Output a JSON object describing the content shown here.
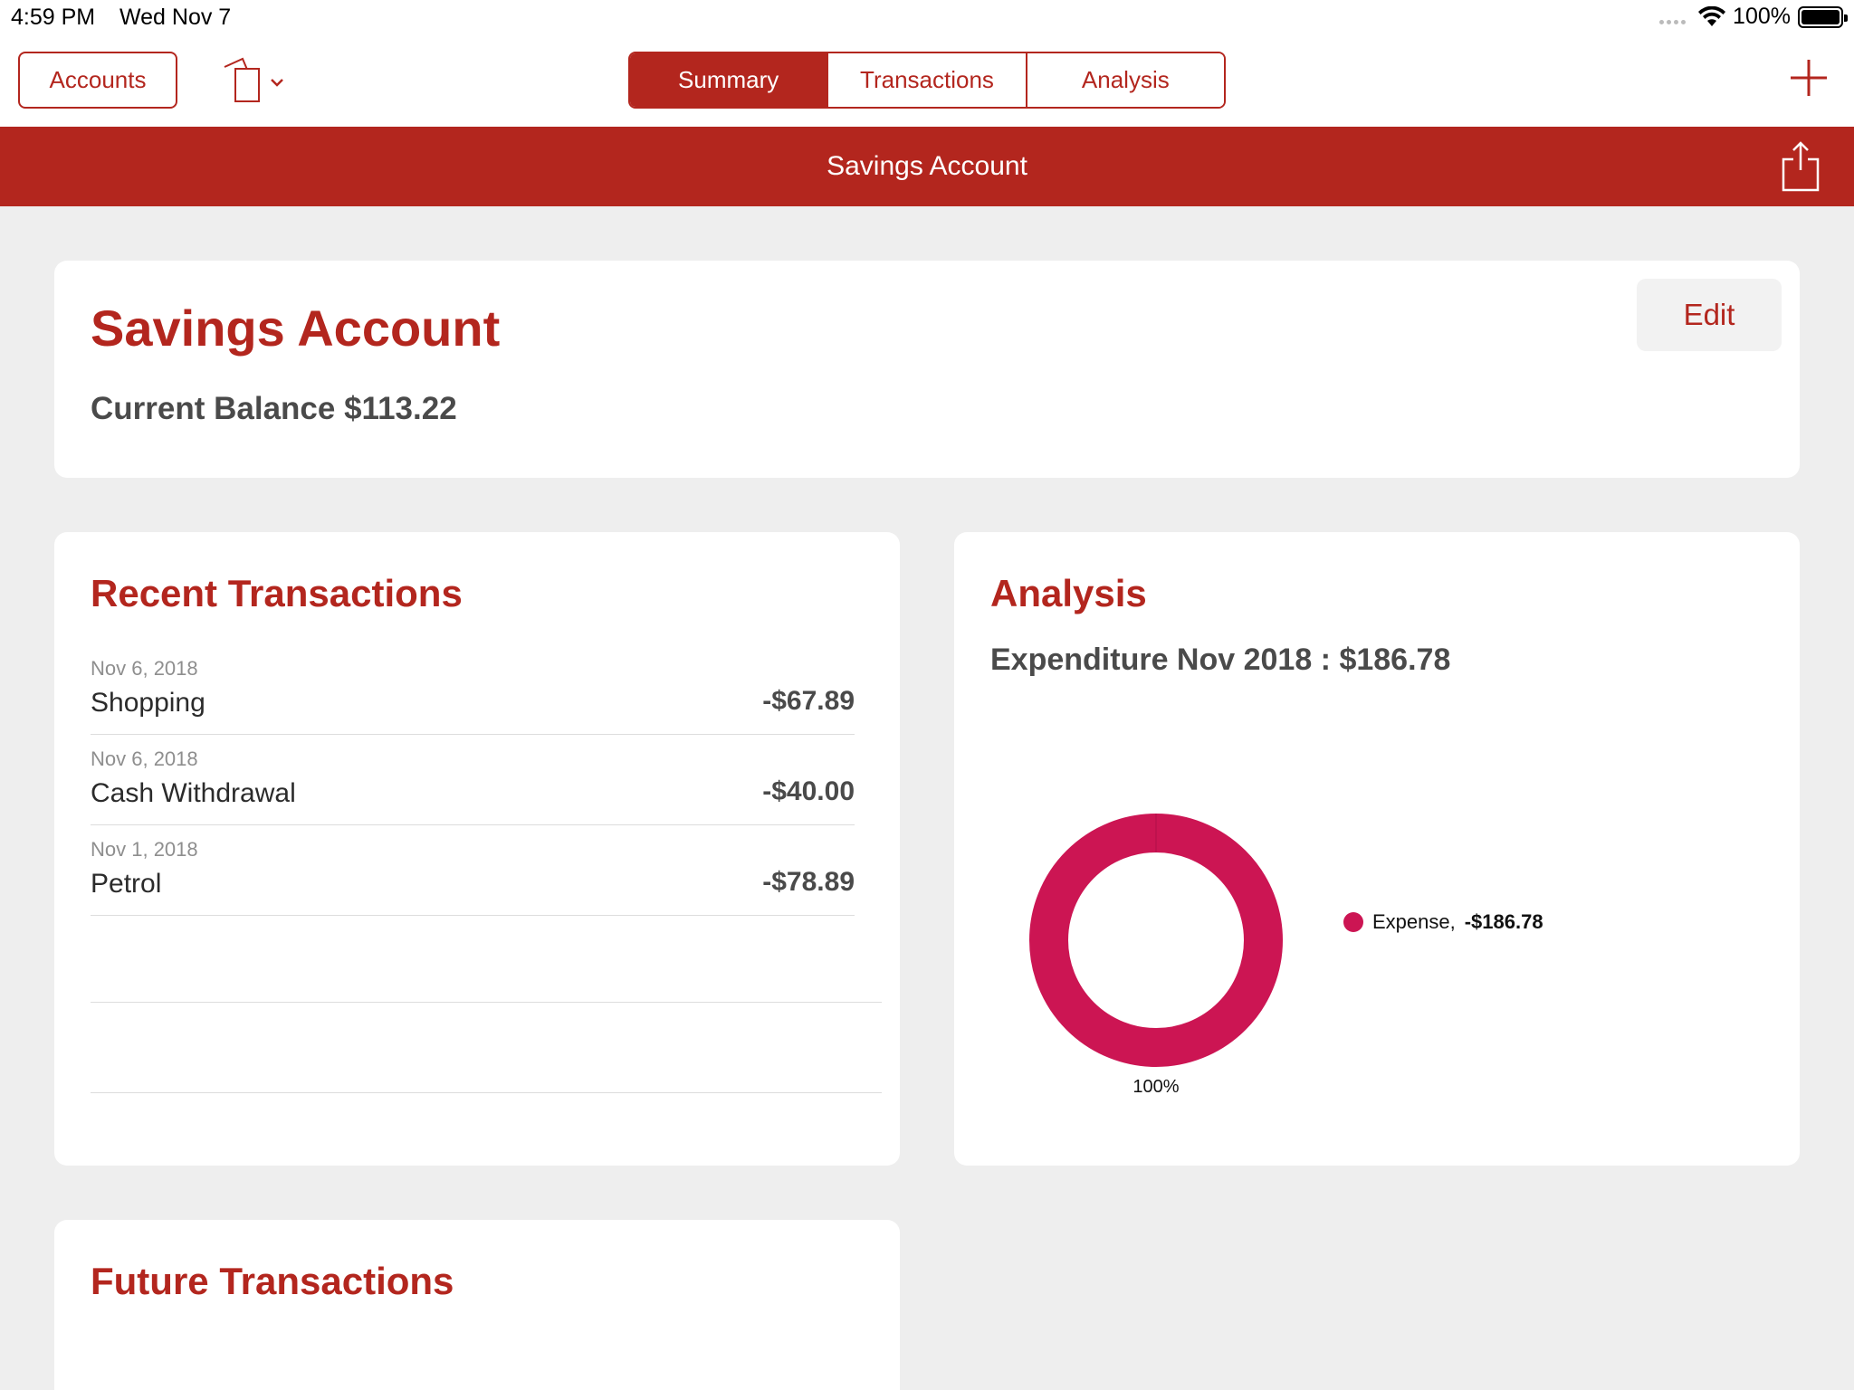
{
  "status_bar": {
    "time": "4:59 PM",
    "date": "Wed Nov 7",
    "battery": "100%",
    "icons": [
      "signal-dots-icon",
      "wifi-icon",
      "battery-icon"
    ]
  },
  "nav": {
    "accounts_label": "Accounts",
    "tabs": [
      {
        "label": "Summary",
        "active": true
      },
      {
        "label": "Transactions",
        "active": false
      },
      {
        "label": "Analysis",
        "active": false
      }
    ],
    "icons": [
      "cards-icon",
      "chevron-down-icon",
      "plus-icon"
    ]
  },
  "title_bar": {
    "title": "Savings Account",
    "icons": [
      "share-icon"
    ]
  },
  "account": {
    "name": "Savings Account",
    "balance_text": "Current Balance $113.22",
    "edit_label": "Edit"
  },
  "recent": {
    "heading": "Recent Transactions",
    "items": [
      {
        "date": "Nov 6, 2018",
        "name": "Shopping",
        "amount": "-$67.89"
      },
      {
        "date": "Nov 6, 2018",
        "name": "Cash Withdrawal",
        "amount": "-$40.00"
      },
      {
        "date": "Nov 1, 2018",
        "name": "Petrol",
        "amount": "-$78.89"
      }
    ]
  },
  "analysis": {
    "heading": "Analysis",
    "expenditure_text": "Expenditure Nov 2018 : $186.78",
    "legend_label": "Expense,",
    "legend_value": "-$186.78",
    "percent_label": "100%"
  },
  "future": {
    "heading": "Future Transactions"
  },
  "colors": {
    "brand_red": "#b3261e",
    "expense_pink": "#cc1553",
    "background": "#eeeeee"
  },
  "chart_data": {
    "type": "pie",
    "categories": [
      "Expense"
    ],
    "values": [
      186.78
    ],
    "labels": [
      "100%"
    ]
  }
}
